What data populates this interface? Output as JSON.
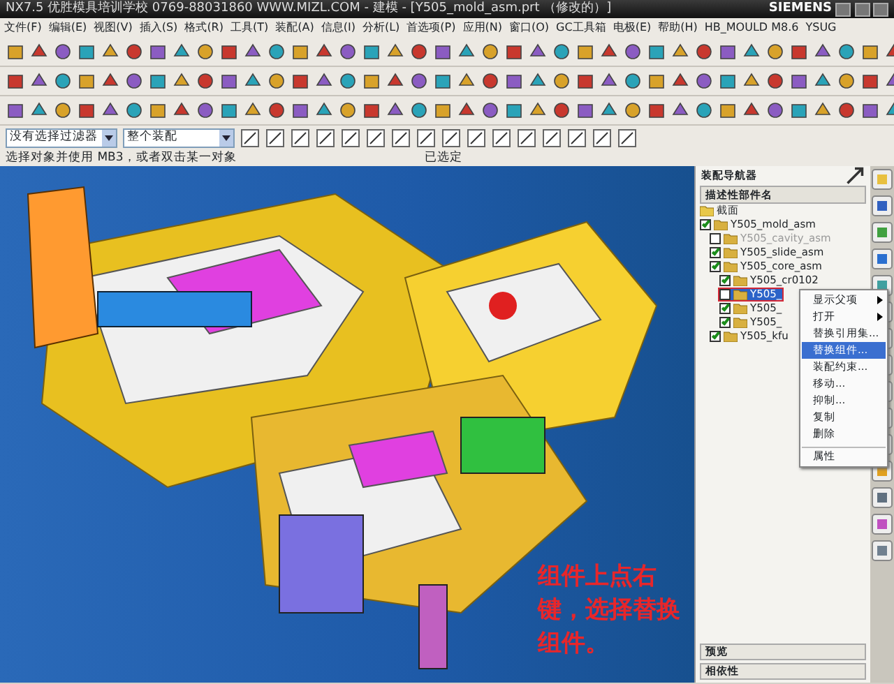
{
  "window": {
    "title": "NX7.5 优胜模具培训学校 0769-88031860 WWW.MIZL.COM - 建模 - [Y505_mold_asm.prt （修改的）]",
    "brand": "SIEMENS"
  },
  "menu": [
    "文件(F)",
    "编辑(E)",
    "视图(V)",
    "插入(S)",
    "格式(R)",
    "工具(T)",
    "装配(A)",
    "信息(I)",
    "分析(L)",
    "首选项(P)",
    "应用(N)",
    "窗口(O)",
    "GC工具箱",
    "电极(E)",
    "帮助(H)",
    "HB_MOULD M8.6",
    "YSUG"
  ],
  "selection_bar": {
    "filter": "没有选择过滤器",
    "scope": "整个装配"
  },
  "status_bar": {
    "prompt": "选择对象并使用 MB3，或者双击某一对象",
    "state": "已选定"
  },
  "annotation": "组件上点右键，选择替换组件。",
  "navigator": {
    "title": "装配导航器",
    "column": "描述性部件名",
    "tree": [
      {
        "kind": "section",
        "label": "截面"
      },
      {
        "kind": "component",
        "label": "Y505_mold_asm",
        "checked": true,
        "dimmed": false,
        "selected": false,
        "children": [
          {
            "kind": "component",
            "label": "Y505_cavity_asm",
            "checked": false,
            "dimmed": true,
            "selected": false
          },
          {
            "kind": "component",
            "label": "Y505_slide_asm",
            "checked": true,
            "dimmed": false,
            "selected": false
          },
          {
            "kind": "component",
            "label": "Y505_core_asm",
            "checked": true,
            "dimmed": false,
            "selected": false,
            "children": [
              {
                "kind": "component",
                "label": "Y505_cr0102",
                "checked": true,
                "dimmed": false,
                "selected": false
              },
              {
                "kind": "component",
                "label": "Y505_",
                "checked": false,
                "dimmed": false,
                "selected": true
              },
              {
                "kind": "component",
                "label": "Y505_",
                "checked": true,
                "dimmed": false,
                "selected": false
              },
              {
                "kind": "component",
                "label": "Y505_",
                "checked": true,
                "dimmed": false,
                "selected": false
              }
            ]
          },
          {
            "kind": "component",
            "label": "Y505_kfu",
            "checked": true,
            "dimmed": false,
            "selected": false
          }
        ]
      }
    ],
    "sections": [
      "预览",
      "相依性"
    ]
  },
  "context_menu": [
    {
      "label": "显示父项",
      "submenu": true,
      "selected": false,
      "separator_before": false
    },
    {
      "label": "打开",
      "submenu": true,
      "selected": false,
      "separator_before": false
    },
    {
      "label": "替换引用集...",
      "submenu": false,
      "selected": false,
      "separator_before": false
    },
    {
      "label": "替换组件...",
      "submenu": false,
      "selected": true,
      "separator_before": false
    },
    {
      "label": "装配约束...",
      "submenu": false,
      "selected": false,
      "separator_before": false
    },
    {
      "label": "移动...",
      "submenu": false,
      "selected": false,
      "separator_before": false
    },
    {
      "label": "抑制...",
      "submenu": false,
      "selected": false,
      "separator_before": false
    },
    {
      "label": "复制",
      "submenu": false,
      "selected": false,
      "separator_before": false
    },
    {
      "label": "删除",
      "submenu": false,
      "selected": false,
      "separator_before": false
    },
    {
      "label": "属性",
      "submenu": false,
      "selected": false,
      "separator_before": true
    }
  ]
}
